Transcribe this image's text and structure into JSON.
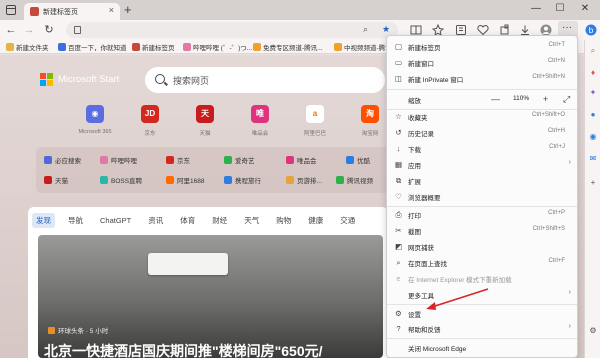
{
  "window": {
    "tab_title": "新建标签页",
    "tab_close": "×",
    "new_tab": "+",
    "controls": {
      "minimize": "—",
      "maximize": "☐",
      "close": "✕"
    }
  },
  "navbar": {
    "back": "←",
    "forward": "→",
    "refresh": "↻",
    "url": "",
    "more": "···"
  },
  "bookmarks": [
    {
      "label": "新建文件夹",
      "color": "#e3b544"
    },
    {
      "label": "百度一下，你就知道",
      "color": "#3b6fe0"
    },
    {
      "label": "新建标签页",
      "color": "#c64a3b"
    },
    {
      "label": "哔哩哔哩 (゜-゜)つ...",
      "color": "#e07aa5"
    },
    {
      "label": "免费专区频道-腾讯...",
      "color": "#f0a030"
    },
    {
      "label": "中视频频道-腾讯...",
      "color": "#f0a030"
    }
  ],
  "page": {
    "brand": "Microsoft Start",
    "search_placeholder": "搜索网页",
    "tiles": [
      {
        "icon": "◉",
        "label": "Microsoft 365",
        "color": "#5b6ee1"
      },
      {
        "icon": "JD",
        "label": "京东",
        "color": "#d2281f"
      },
      {
        "icon": "天",
        "label": "天猫",
        "color": "#c81b1b"
      },
      {
        "icon": "唯",
        "label": "唯品会",
        "color": "#e0337d"
      },
      {
        "icon": "a",
        "label": "阿里巴巴",
        "color": "#ff6a00"
      },
      {
        "icon": "淘",
        "label": "淘宝网",
        "color": "#ff5000"
      }
    ],
    "quick_links": [
      {
        "label": "必应搜索",
        "color": "#4e6ad8"
      },
      {
        "label": "哔哩哔哩",
        "color": "#e07aa5"
      },
      {
        "label": "京东",
        "color": "#d2281f"
      },
      {
        "label": "爱奇艺",
        "color": "#2cb14b"
      },
      {
        "label": "唯品会",
        "color": "#e0337d"
      },
      {
        "label": "优酷",
        "color": "#2a7de1"
      },
      {
        "label": "天猫",
        "color": "#c81b1b"
      },
      {
        "label": "BOSS直聘",
        "color": "#2bb7a7"
      },
      {
        "label": "阿里1688",
        "color": "#ff6a00"
      },
      {
        "label": "携程旅行",
        "color": "#2e7de1"
      },
      {
        "label": "页游排...",
        "color": "#e8a23a"
      },
      {
        "label": "腾讯视频",
        "color": "#2cb14b"
      }
    ],
    "feed_tabs": [
      "发现",
      "导航",
      "ChatGPT",
      "资讯",
      "体育",
      "财经",
      "天气",
      "购物",
      "健康",
      "交通"
    ],
    "feed_source": "环球头条 · 5 小时",
    "feed_headline": "北京一快捷酒店国庆期间推\"楼梯间房\"650元/"
  },
  "menu": {
    "items": [
      {
        "icon": "▢",
        "label": "新建标签页",
        "shortcut": "Ctrl+T"
      },
      {
        "icon": "▭",
        "label": "新建窗口",
        "shortcut": "Ctrl+N"
      },
      {
        "icon": "◫",
        "label": "新建 InPrivate 窗口",
        "shortcut": "Ctrl+Shift+N"
      },
      {
        "icon": "☆",
        "label": "收藏夹",
        "shortcut": "Ctrl+Shift+O"
      },
      {
        "icon": "↺",
        "label": "历史记录",
        "shortcut": "Ctrl+H"
      },
      {
        "icon": "↓",
        "label": "下载",
        "shortcut": "Ctrl+J"
      },
      {
        "icon": "▦",
        "label": "应用",
        "shortcut": "",
        "submenu": true
      },
      {
        "icon": "⧉",
        "label": "扩展",
        "shortcut": ""
      },
      {
        "icon": "♡",
        "label": "浏览器概要",
        "shortcut": ""
      },
      {
        "icon": "⎙",
        "label": "打印",
        "shortcut": "Ctrl+P"
      },
      {
        "icon": "✂",
        "label": "截图",
        "shortcut": "Ctrl+Shift+S"
      },
      {
        "icon": "◩",
        "label": "网页捕获",
        "shortcut": ""
      },
      {
        "icon": "⌕",
        "label": "在页面上查找",
        "shortcut": "Ctrl+F"
      },
      {
        "icon": "e",
        "label": "在 Internet Explorer 模式下重新加载",
        "shortcut": "",
        "disabled": true
      },
      {
        "icon": "",
        "label": "更多工具",
        "shortcut": "",
        "submenu": true
      },
      {
        "icon": "⚙",
        "label": "设置",
        "shortcut": ""
      },
      {
        "icon": "?",
        "label": "帮助和反馈",
        "shortcut": "",
        "submenu": true
      },
      {
        "icon": "",
        "label": "关闭 Microsoft Edge",
        "shortcut": ""
      }
    ],
    "zoom": {
      "label": "缩放",
      "minus": "—",
      "value": "110%",
      "plus": "+",
      "fullscreen": "⤢"
    }
  },
  "colors": {
    "accent": "#2563c3",
    "annotation": "#d9242a"
  }
}
